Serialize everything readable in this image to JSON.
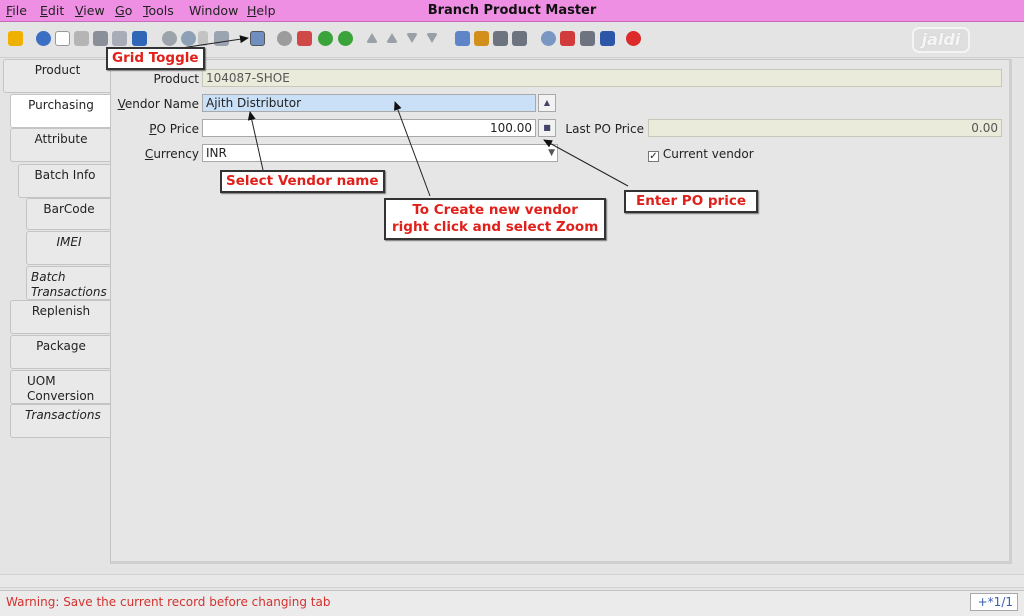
{
  "window_title": "Branch Product Master",
  "menu": [
    {
      "mn": "F",
      "rest": "ile"
    },
    {
      "mn": "E",
      "rest": "dit"
    },
    {
      "mn": "V",
      "rest": "iew"
    },
    {
      "mn": "G",
      "rest": "o"
    },
    {
      "mn": "T",
      "rest": "ools"
    },
    {
      "mn": "",
      "rest": "Window"
    },
    {
      "mn": "H",
      "rest": "elp"
    }
  ],
  "logo_text": "jaldi",
  "tabs": {
    "product": "Product",
    "purchasing": "Purchasing",
    "attribute": "Attribute",
    "batch_info": "Batch Info",
    "barcode": "BarCode",
    "imei": "IMEI",
    "batch_transactions": "Batch Transactions",
    "replenish": "Replenish",
    "package": "Package",
    "uom_conversion": "UOM Conversion",
    "transactions": "Transactions"
  },
  "form": {
    "product_label": "Product",
    "product_value": "104087-SHOE",
    "vendor_label_mn": "V",
    "vendor_label_rest": "endor Name",
    "vendor_value": "Ajith Distributor",
    "po_price_label_mn": "P",
    "po_price_label_rest": "O Price",
    "po_price_value": "100.00",
    "last_po_price_label": "Last PO Price",
    "last_po_price_value": "0.00",
    "currency_label_mn": "C",
    "currency_label_rest": "urrency",
    "currency_value": "INR",
    "current_vendor_label": "Current vendor",
    "current_vendor_checked": true
  },
  "annotations": {
    "grid_toggle": "Grid Toggle",
    "select_vendor": "Select Vendor name",
    "create_vendor_line1": "To Create new vendor",
    "create_vendor_line2": "right click and select Zoom",
    "enter_po_price": "Enter PO price"
  },
  "status": {
    "message": "Warning: Save the current record before changing tab",
    "record_count": "+*1/1"
  },
  "colors": {
    "titlebar": "#ef8fe4",
    "highlight_field": "#c9e0f7",
    "annotation_text": "#e0201a",
    "status_warning": "#d3322e"
  }
}
